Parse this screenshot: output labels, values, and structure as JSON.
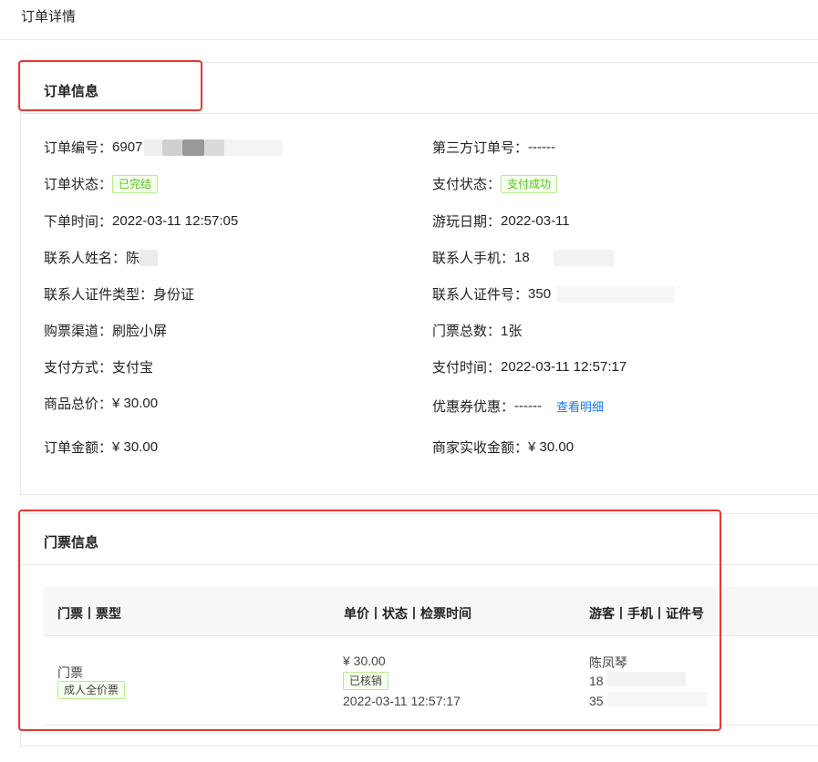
{
  "page": {
    "title": "订单详情"
  },
  "order_info": {
    "title": "订单信息",
    "order_no": {
      "label": "订单编号：",
      "value": "6907"
    },
    "third_party_no": {
      "label": "第三方订单号：",
      "value": "------"
    },
    "order_status": {
      "label": "订单状态：",
      "value": "已完结"
    },
    "pay_status": {
      "label": "支付状态：",
      "value": "支付成功"
    },
    "order_time": {
      "label": "下单时间：",
      "value": "2022-03-11 12:57:05"
    },
    "visit_date": {
      "label": "游玩日期：",
      "value": "2022-03-11"
    },
    "contact_name": {
      "label": "联系人姓名：",
      "value": "陈"
    },
    "contact_phone": {
      "label": "联系人手机：",
      "value": "18"
    },
    "id_type": {
      "label": "联系人证件类型：",
      "value": "身份证"
    },
    "id_no": {
      "label": "联系人证件号：",
      "value": "350"
    },
    "channel": {
      "label": "购票渠道：",
      "value": "刷脸小屏"
    },
    "ticket_count": {
      "label": "门票总数：",
      "value": "1张"
    },
    "pay_method": {
      "label": "支付方式：",
      "value": "支付宝"
    },
    "pay_time": {
      "label": "支付时间：",
      "value": "2022-03-11 12:57:17"
    },
    "goods_total": {
      "label": "商品总价：",
      "value": "¥ 30.00"
    },
    "coupon": {
      "label": "优惠券优惠：",
      "value": "------",
      "link": "查看明细"
    },
    "order_amount": {
      "label": "订单金额：",
      "value": "¥ 30.00"
    },
    "merchant_amount": {
      "label": "商家实收金额：",
      "value": "¥ 30.00"
    }
  },
  "ticket_info": {
    "title": "门票信息",
    "columns": [
      "门票丨票型",
      "单价丨状态丨检票时间",
      "游客丨手机丨证件号"
    ],
    "rows": [
      {
        "ticket_name": "门票",
        "ticket_type": "成人全价票",
        "price": "¥ 30.00",
        "status": "已核销",
        "check_time": "2022-03-11 12:57:17",
        "visitor_name": "陈凤琴",
        "visitor_phone": "18",
        "visitor_id": "35"
      }
    ]
  },
  "colors": {
    "accent_red": "#e53935",
    "link_blue": "#1677ff",
    "success_green": "#52c41a"
  }
}
